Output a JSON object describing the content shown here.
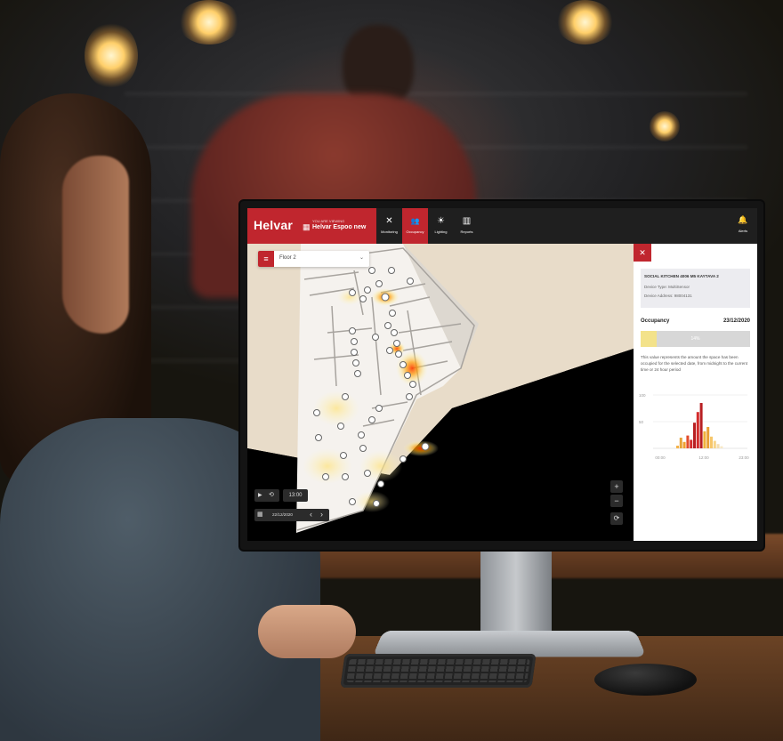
{
  "app": {
    "brand": "Helvar",
    "viewing_label": "YOU ARE VIEWING",
    "site_name": "Helvar Espoo new"
  },
  "nav": [
    {
      "label": "Monitoring",
      "icon": "tools-icon",
      "glyph": "✕",
      "active": false
    },
    {
      "label": "Occupancy",
      "icon": "people-icon",
      "glyph": "👥",
      "active": true
    },
    {
      "label": "Lighting",
      "icon": "lighting-icon",
      "glyph": "☀",
      "active": false
    },
    {
      "label": "Reports",
      "icon": "reports-icon",
      "glyph": "▥",
      "active": false
    }
  ],
  "alerts": {
    "label": "Alerts",
    "icon": "bell-icon",
    "glyph": "🔔"
  },
  "zone": {
    "menu_glyph": "≡",
    "name": "Floor 2",
    "chevron": "⌄"
  },
  "playback": {
    "play_glyph": "▶",
    "history_glyph": "⟲",
    "time": "13:00"
  },
  "date_control": {
    "calendar_glyph": "▦",
    "date": "22/12/2020",
    "prev_glyph": "‹",
    "next_glyph": "›"
  },
  "zoom": {
    "in": "+",
    "out": "−",
    "reset": "⟳"
  },
  "panel": {
    "close_glyph": "✕",
    "device_name": "SOCIAL KITCHEN 4006 M5 KAYTAVA 2",
    "device_type": "Device Type: MultiSensor",
    "device_address": "Device Address: 98004131",
    "occupancy_label": "Occupancy",
    "date": "23/12/2020",
    "occupancy_fraction": 0.15,
    "occupancy_text": "14%",
    "description": "This value represents the amount the space has been occupied for the selected date, from midnight to the current time or 24 hour period"
  },
  "chart_data": {
    "type": "bar",
    "y_tick_labels": [
      "100",
      "50"
    ],
    "x_tick_labels": [
      "00:00",
      "12:00",
      "23:00"
    ],
    "ylim": [
      0,
      100
    ],
    "values": [
      5,
      20,
      12,
      24,
      16,
      48,
      68,
      85,
      32,
      40,
      22,
      14,
      8,
      4
    ],
    "colors": [
      "#f5b24a",
      "#e6a43a",
      "#f0a02d",
      "#e24b2b",
      "#d32b2b",
      "#b81f22",
      "#d32b2b",
      "#b81f22",
      "#f1b13a",
      "#e8a034",
      "#f6c66a",
      "#f7d488",
      "#f3ddb0",
      "#f8e8c6"
    ]
  },
  "colors": {
    "accent": "#c0262e"
  }
}
